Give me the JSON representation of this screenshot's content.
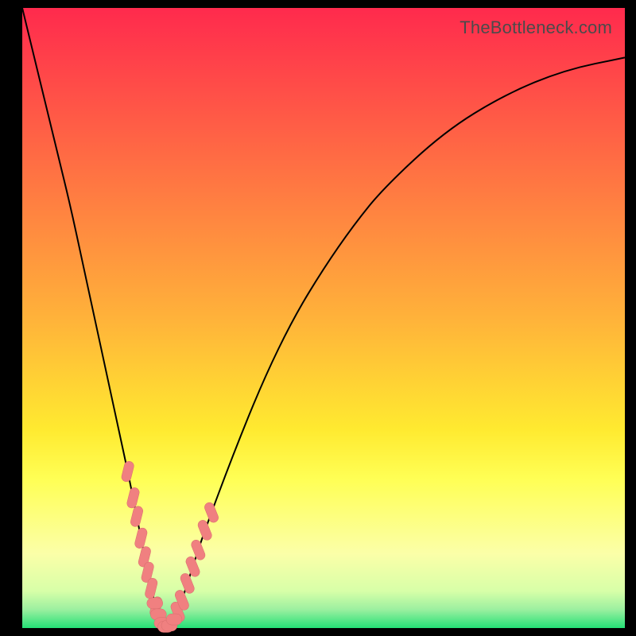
{
  "watermark": "TheBottleneck.com",
  "colors": {
    "gradient": {
      "c0": "#ff2a4d",
      "c1": "#ffb23a",
      "c2": "#ffea30",
      "c3": "#ffff55",
      "c4": "#fbffa8",
      "c5": "#d8ffa8",
      "c6": "#9cf0a0",
      "c7": "#24e076"
    },
    "curve_stroke": "#000000",
    "marker_fill": "#f08080"
  },
  "chart_data": {
    "type": "line",
    "title": "",
    "xlabel": "",
    "ylabel": "",
    "xlim": [
      0,
      100
    ],
    "ylim": [
      0,
      100
    ],
    "x": [
      0,
      2,
      4,
      6,
      8,
      10,
      12,
      14,
      16,
      18,
      20,
      21,
      22,
      23,
      24,
      25,
      26,
      28,
      30,
      35,
      40,
      45,
      50,
      55,
      60,
      70,
      80,
      90,
      100
    ],
    "y": [
      100,
      92,
      84,
      76,
      68,
      59,
      50,
      41,
      32,
      23,
      13,
      8,
      4,
      1,
      0,
      1,
      3,
      9,
      15,
      28,
      40,
      50,
      58,
      65,
      71,
      80,
      86,
      90,
      92
    ],
    "vertex_x": 23.5,
    "markers": {
      "left_branch_x": [
        17.5,
        18.4,
        19.0,
        19.7,
        20.3,
        20.8,
        21.4,
        22.2
      ],
      "right_branch_x": [
        25.8,
        26.5,
        27.4,
        28.3,
        29.2,
        30.3,
        31.4
      ],
      "bottom_x": [
        22.0,
        22.6,
        23.2,
        23.8,
        24.4,
        25.2
      ]
    }
  }
}
